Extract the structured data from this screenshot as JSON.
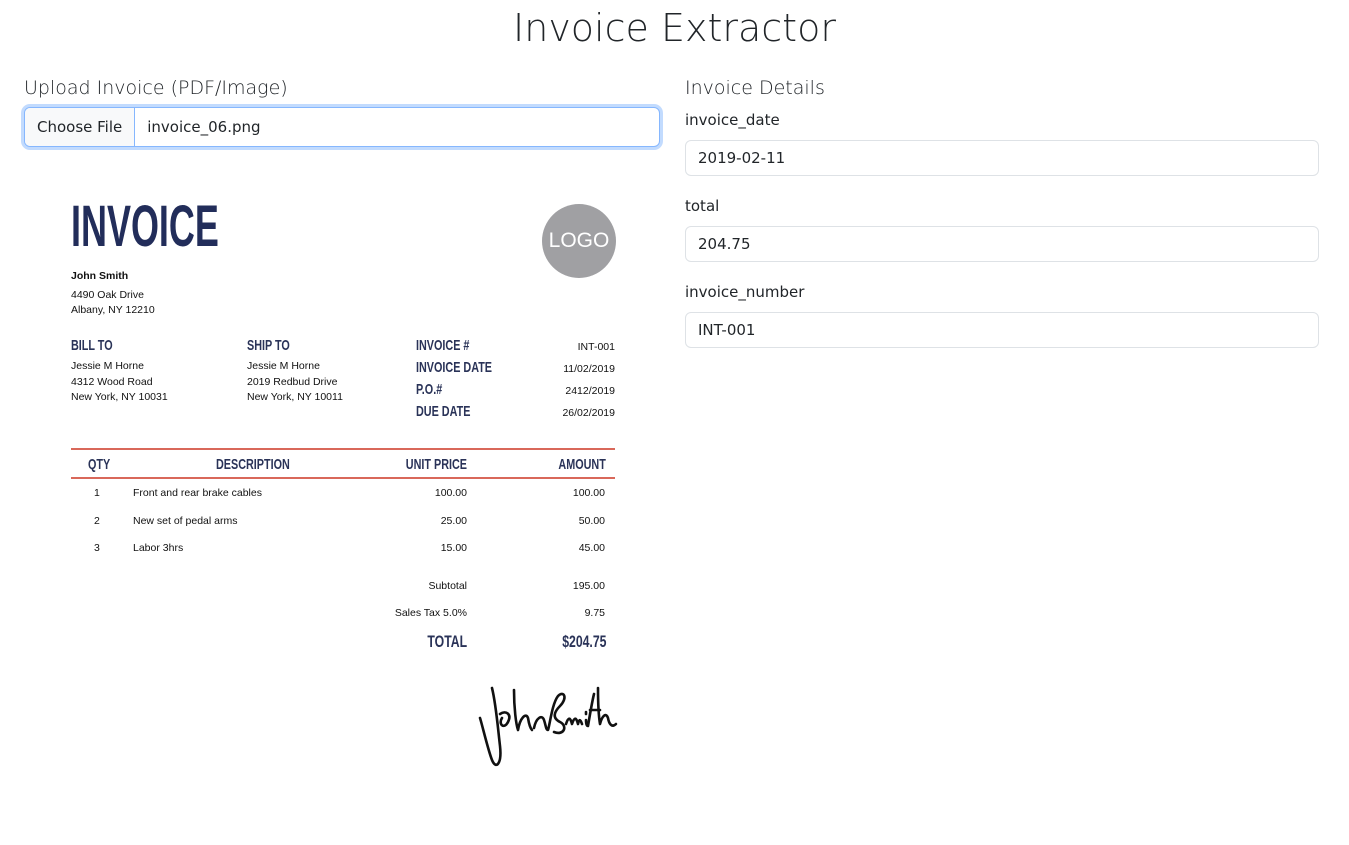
{
  "page": {
    "title": "Invoice Extractor"
  },
  "upload": {
    "label": "Upload Invoice (PDF/Image)",
    "button": "Choose File",
    "file_name": "invoice_06.png"
  },
  "details": {
    "title": "Invoice Details",
    "fields": [
      {
        "label": "invoice_date",
        "value": "2019-02-11"
      },
      {
        "label": "total",
        "value": "204.75"
      },
      {
        "label": "invoice_number",
        "value": "INT-001"
      }
    ]
  },
  "invoice_image": {
    "heading": "INVOICE",
    "logo": "LOGO",
    "from": {
      "name": "John Smith",
      "lines": [
        "4490 Oak Drive",
        "Albany, NY 12210"
      ]
    },
    "bill_to": {
      "label": "BILL TO",
      "lines": [
        "Jessie M Horne",
        "4312 Wood Road",
        "New York, NY 10031"
      ]
    },
    "ship_to": {
      "label": "SHIP TO",
      "lines": [
        "Jessie M Horne",
        "2019 Redbud Drive",
        "New York, NY 10011"
      ]
    },
    "meta": [
      {
        "label": "INVOICE #",
        "value": "INT-001"
      },
      {
        "label": "INVOICE DATE",
        "value": "11/02/2019"
      },
      {
        "label": "P.O.#",
        "value": "2412/2019"
      },
      {
        "label": "DUE DATE",
        "value": "26/02/2019"
      }
    ],
    "columns": [
      "QTY",
      "DESCRIPTION",
      "UNIT PRICE",
      "AMOUNT"
    ],
    "items": [
      {
        "qty": "1",
        "description": "Front and rear brake cables",
        "unit_price": "100.00",
        "amount": "100.00"
      },
      {
        "qty": "2",
        "description": "New set of pedal arms",
        "unit_price": "25.00",
        "amount": "50.00"
      },
      {
        "qty": "3",
        "description": "Labor 3hrs",
        "unit_price": "15.00",
        "amount": "45.00"
      }
    ],
    "subtotal": {
      "label": "Subtotal",
      "value": "195.00"
    },
    "tax": {
      "label": "Sales Tax 5.0%",
      "value": "9.75"
    },
    "total": {
      "label": "TOTAL",
      "value": "$204.75"
    },
    "signature": "John Smith",
    "colors": {
      "navy": "#2a3358",
      "rule": "#d9685a",
      "logo": "#a0a0a3"
    }
  }
}
